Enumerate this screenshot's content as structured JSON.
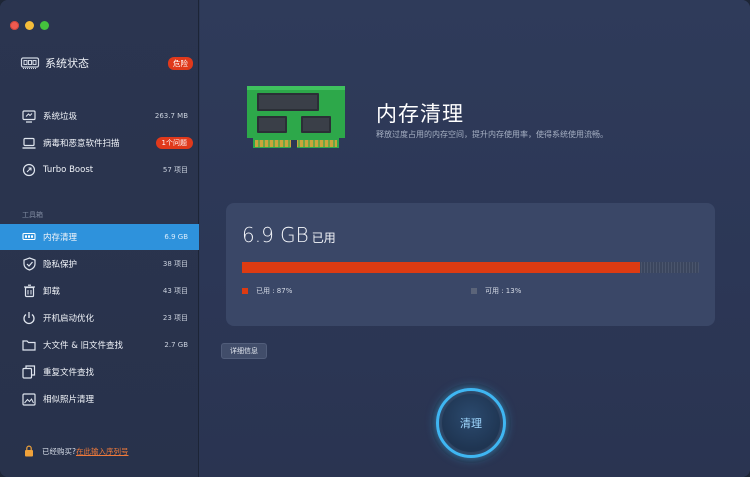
{
  "sidebar": {
    "status": {
      "title": "系统状态",
      "badge": "危险"
    },
    "top_items": [
      {
        "label": "系统垃圾",
        "value": "263.7 MB",
        "icon": "monitor-icon"
      },
      {
        "label": "病毒和恶意软件扫描",
        "badge": "1个问题",
        "icon": "laptop-shield-icon"
      },
      {
        "label": "Turbo Boost",
        "value": "57 项目",
        "icon": "rocket-icon"
      }
    ],
    "section_label": "工具箱",
    "tool_items": [
      {
        "label": "内存清理",
        "value": "6.9 GB",
        "icon": "memory-icon",
        "active": true
      },
      {
        "label": "隐私保护",
        "value": "38 项目",
        "icon": "shield-check-icon"
      },
      {
        "label": "卸载",
        "value": "43 项目",
        "icon": "trash-icon"
      },
      {
        "label": "开机启动优化",
        "value": "23 项目",
        "icon": "power-icon"
      },
      {
        "label": "大文件 & 旧文件查找",
        "value": "2.7 GB",
        "icon": "folder-icon"
      },
      {
        "label": "重复文件查找",
        "icon": "duplicate-files-icon"
      },
      {
        "label": "相似照片清理",
        "icon": "photo-icon"
      }
    ],
    "footer": {
      "text": "已经购买?",
      "link": "在此输入序列号"
    }
  },
  "main": {
    "title": "内存清理",
    "subtitle": "释放过度占用的内存空间，提升内存使用率，使得系统使用流畅。",
    "usage": {
      "value": "6.9 GB",
      "unit": "已用",
      "used_label": "已用 : 87%",
      "available_label": "可用 : 13%",
      "used_fraction": 0.87
    },
    "details_button": "详细信息",
    "clean_button": "清理"
  },
  "colors": {
    "accent": "#2e92dc",
    "danger": "#e0391b",
    "used": "#dd3b12",
    "available": "#3b465e",
    "ring": "#3fb6f2"
  }
}
